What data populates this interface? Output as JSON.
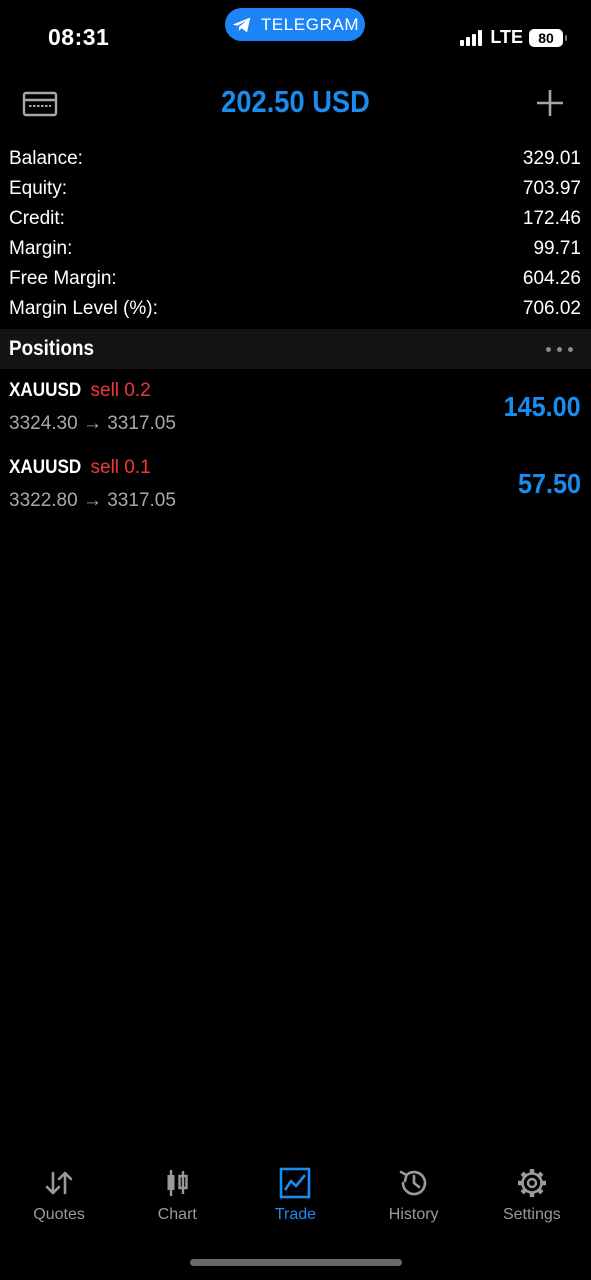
{
  "status_bar": {
    "time": "08:31",
    "pill_label": "TELEGRAM",
    "network": "LTE",
    "battery": "80"
  },
  "header": {
    "title": "202.50 USD",
    "left_icon": "card-icon",
    "right_icon": "plus-icon"
  },
  "summary": [
    {
      "label": "Balance:",
      "value": "329.01"
    },
    {
      "label": "Equity:",
      "value": "703.97"
    },
    {
      "label": "Credit:",
      "value": "172.46"
    },
    {
      "label": "Margin:",
      "value": "99.71"
    },
    {
      "label": "Free Margin:",
      "value": "604.26"
    },
    {
      "label": "Margin Level (%):",
      "value": "706.02"
    }
  ],
  "positions": {
    "title": "Positions",
    "items": [
      {
        "symbol": "XAUUSD",
        "direction": "sell 0.2",
        "prices": "3324.30 → 3317.05",
        "profit": "145.00"
      },
      {
        "symbol": "XAUUSD",
        "direction": "sell 0.1",
        "prices": "3322.80 → 3317.05",
        "profit": "57.50"
      }
    ]
  },
  "tabs": [
    {
      "label": "Quotes",
      "icon": "quotes-icon",
      "active": false
    },
    {
      "label": "Chart",
      "icon": "chart-icon",
      "active": false
    },
    {
      "label": "Trade",
      "icon": "trade-icon",
      "active": true
    },
    {
      "label": "History",
      "icon": "history-icon",
      "active": false
    },
    {
      "label": "Settings",
      "icon": "settings-icon",
      "active": false
    }
  ],
  "colors": {
    "accent": "#1a8cf0",
    "sell": "#f0383a",
    "telegram_pill": "#1d84f5",
    "background": "#000000"
  }
}
